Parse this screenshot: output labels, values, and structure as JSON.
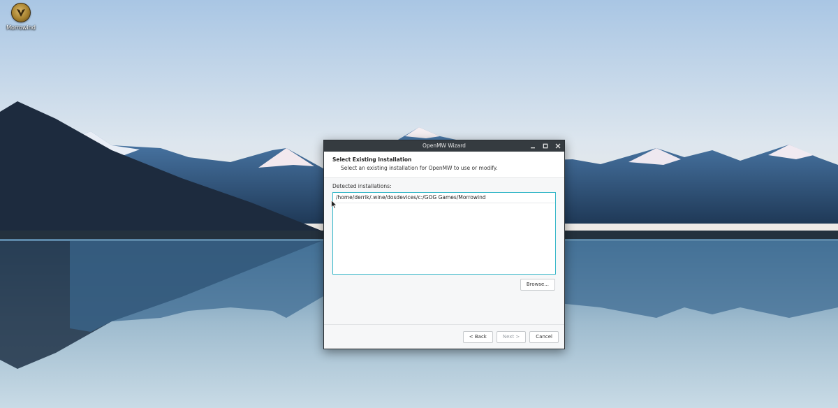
{
  "desktop": {
    "icons": [
      {
        "label": "Morrowind",
        "icon": "morrowind-app-icon"
      }
    ]
  },
  "window": {
    "title": "OpenMW Wizard",
    "controls": {
      "minimize": "minimize-icon",
      "maximize": "maximize-icon",
      "close": "close-icon"
    },
    "header": {
      "title": "Select Existing Installation",
      "subtitle": "Select an existing installation for OpenMW to use or modify."
    },
    "detected_label": "Detected installations:",
    "installations": [
      "/home/derrik/.wine/dosdevices/c:/GOG Games/Morrowind"
    ],
    "browse_label": "Browse...",
    "footer": {
      "back_label": "< Back",
      "next_label": "Next >",
      "cancel_label": "Cancel"
    }
  },
  "colors": {
    "titlebar": "#353b40",
    "accent": "#36b7c8",
    "window_bg": "#f6f7f8"
  }
}
